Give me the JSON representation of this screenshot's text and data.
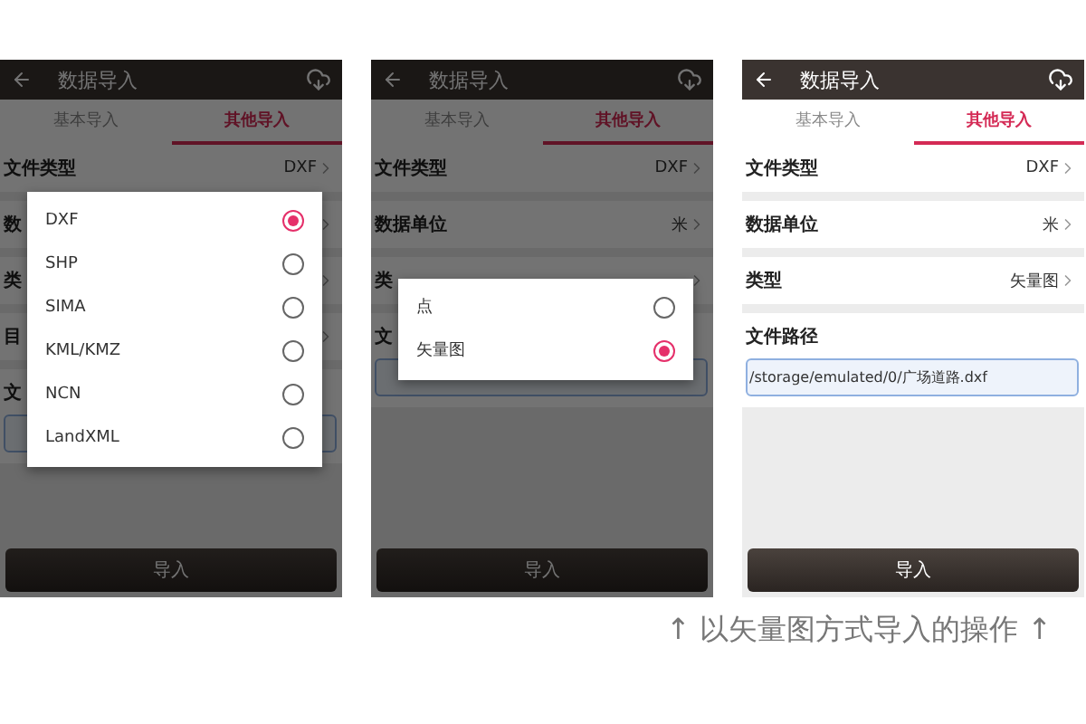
{
  "screens": [
    {
      "title": "数据导入",
      "tabs": [
        {
          "label": "基本导入",
          "selected": false
        },
        {
          "label": "其他导入",
          "selected": true
        }
      ],
      "rows": [
        {
          "kind": "select",
          "label": "文件类型",
          "value": "DXF"
        },
        {
          "kind": "select",
          "label": "数"
        },
        {
          "kind": "select",
          "label": "类"
        },
        {
          "kind": "select",
          "label": "目"
        },
        {
          "kind": "path",
          "label": "文"
        }
      ],
      "button": "导入",
      "dialog": {
        "options": [
          {
            "label": "DXF",
            "selected": true
          },
          {
            "label": "SHP",
            "selected": false
          },
          {
            "label": "SIMA",
            "selected": false
          },
          {
            "label": "KML/KMZ",
            "selected": false
          },
          {
            "label": "NCN",
            "selected": false
          },
          {
            "label": "LandXML",
            "selected": false
          }
        ]
      }
    },
    {
      "title": "数据导入",
      "tabs": [
        {
          "label": "基本导入",
          "selected": false
        },
        {
          "label": "其他导入",
          "selected": true
        }
      ],
      "rows": [
        {
          "kind": "select",
          "label": "文件类型",
          "value": "DXF"
        },
        {
          "kind": "select",
          "label": "数据单位",
          "value": "米"
        },
        {
          "kind": "select",
          "label": "类"
        },
        {
          "kind": "path",
          "label": "文"
        }
      ],
      "button": "导入",
      "dialog": {
        "options": [
          {
            "label": "点",
            "selected": false
          },
          {
            "label": "矢量图",
            "selected": true
          }
        ]
      }
    },
    {
      "title": "数据导入",
      "tabs": [
        {
          "label": "基本导入",
          "selected": false
        },
        {
          "label": "其他导入",
          "selected": true
        }
      ],
      "rows": [
        {
          "kind": "select",
          "label": "文件类型",
          "value": "DXF"
        },
        {
          "kind": "select",
          "label": "数据单位",
          "value": "米"
        },
        {
          "kind": "select",
          "label": "类型",
          "value": "矢量图"
        },
        {
          "kind": "path",
          "label": "文件路径",
          "value": "/storage/emulated/0/广场道路.dxf"
        }
      ],
      "button": "导入"
    }
  ],
  "caption": "↑ 以矢量图方式导入的操作 ↑"
}
